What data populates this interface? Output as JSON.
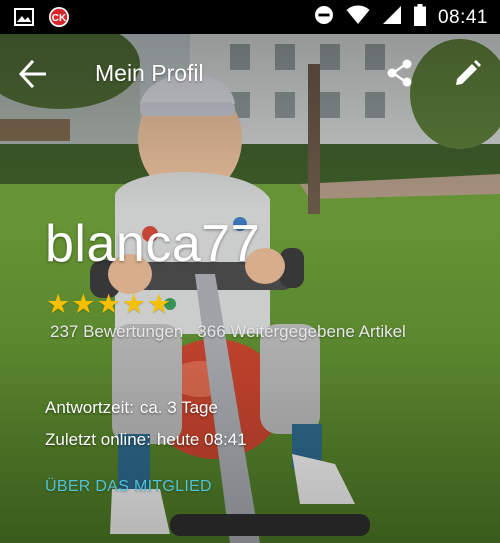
{
  "status_bar": {
    "time": "08:41",
    "left_icons": [
      "image-icon",
      "ck-app-icon"
    ],
    "right_icons": [
      "do-not-disturb-icon",
      "wifi-icon",
      "signal-icon",
      "battery-icon"
    ]
  },
  "toolbar": {
    "title": "Mein Profil",
    "back_icon": "arrow-back-icon",
    "share_icon": "share-icon",
    "edit_icon": "edit-pencil-icon"
  },
  "profile": {
    "username": "blanca77",
    "rating_stars": 5,
    "ratings_count": "237 Bewertungen",
    "items_count": "366 Weitergegebene Artikel",
    "response_time_label": "Antwortzeit:",
    "response_time_value": "ca. 3 Tage",
    "last_online_label": "Zuletzt online:",
    "last_online_value": "heute 08:41",
    "about_link": "ÜBER DAS MITGLIED"
  },
  "colors": {
    "accent_link": "#4fc3d9",
    "star": "#f6c000",
    "status_bar": "#000000"
  }
}
